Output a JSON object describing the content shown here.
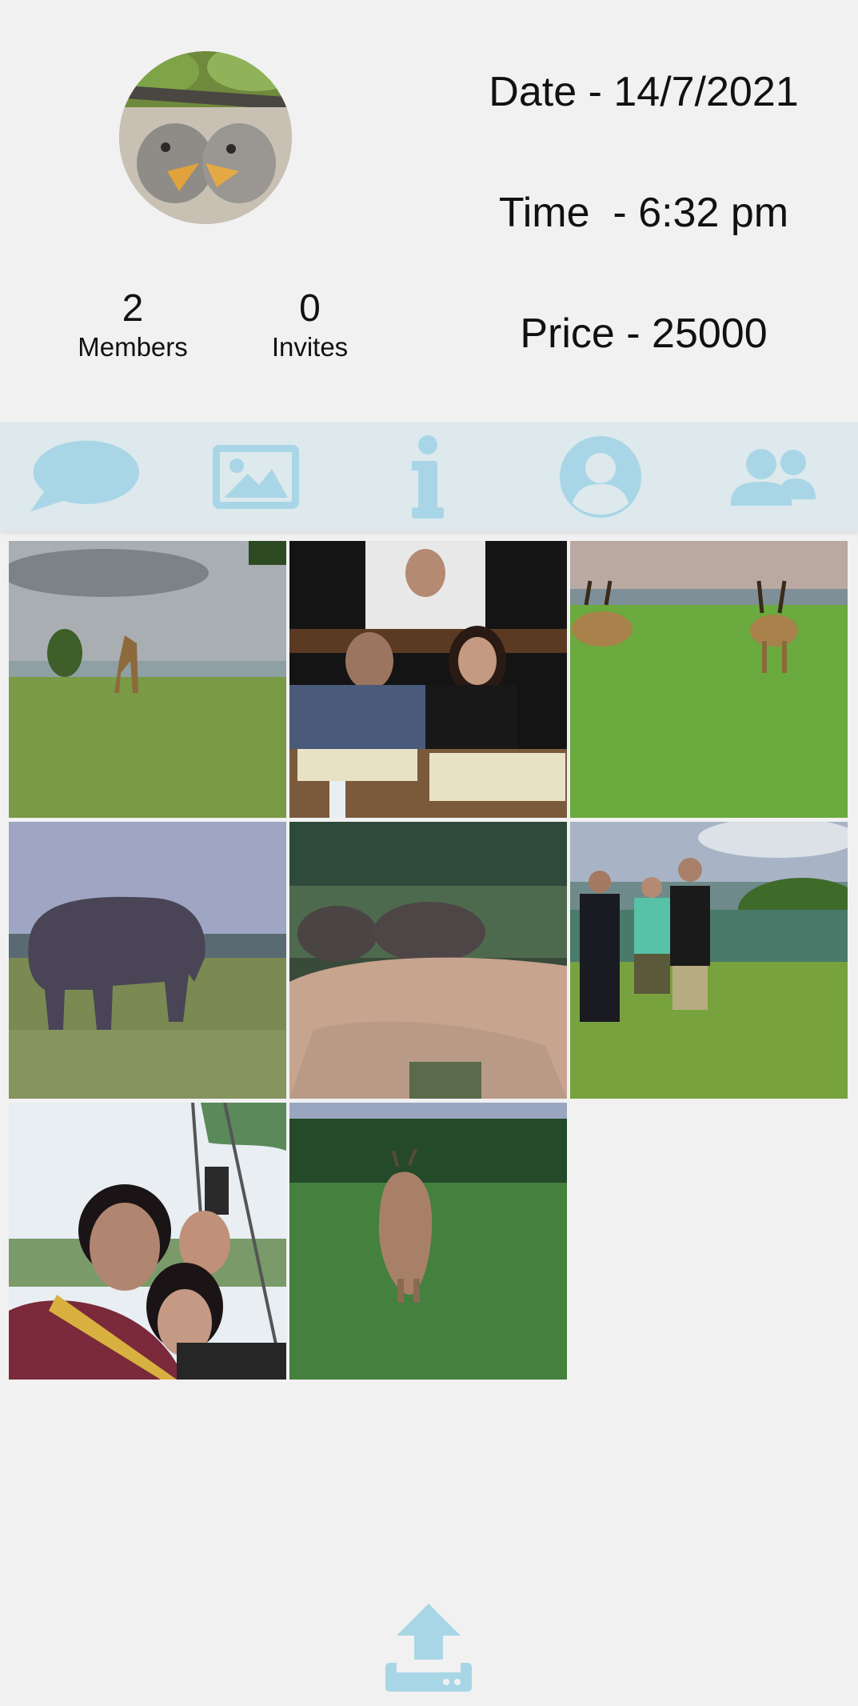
{
  "group": {
    "members_count": "2",
    "members_label": "Members",
    "invites_count": "0",
    "invites_label": "Invites",
    "date_text": "Date - 14/7/2021",
    "time_text": "Time  - 6:32 pm",
    "price_text": "Price - 25000"
  },
  "tabs": [
    {
      "icon": "chat-bubble-icon"
    },
    {
      "icon": "image-icon"
    },
    {
      "icon": "info-icon"
    },
    {
      "icon": "person-circle-icon"
    },
    {
      "icon": "group-icon"
    }
  ],
  "photos": [
    {
      "subject": "giraffe in savanna"
    },
    {
      "subject": "family at dinner table"
    },
    {
      "subject": "antelopes on grass"
    },
    {
      "subject": "elephant grazing"
    },
    {
      "subject": "elephants behind rock"
    },
    {
      "subject": "three people by river"
    },
    {
      "subject": "selfie in hot air balloon"
    },
    {
      "subject": "antelope in grass"
    }
  ],
  "colors": {
    "accent": "#a9d6e6",
    "tabbar_bg": "#dde9ec",
    "page_bg": "#f1f1f1"
  }
}
